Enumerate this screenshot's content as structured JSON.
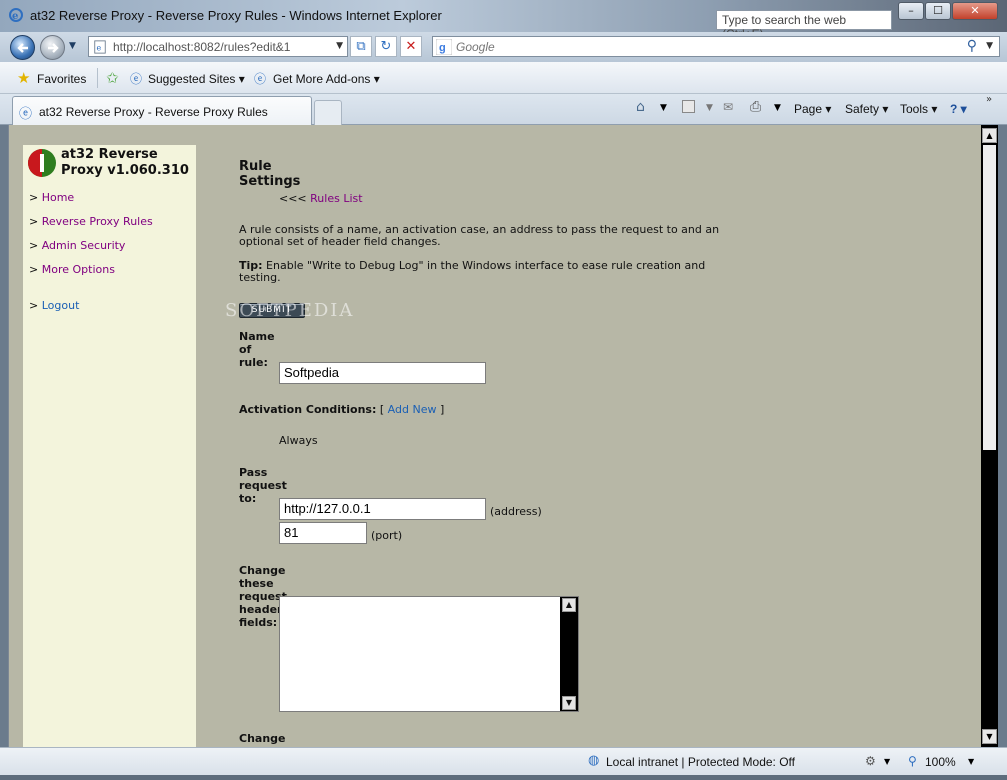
{
  "window": {
    "title": "at32 Reverse Proxy - Reverse Proxy Rules - Windows Internet Explorer",
    "search_web_placeholder": "Type to search the web (Ctrl+E)",
    "min_glyph": "–",
    "max_glyph": "☐",
    "close_glyph": "✕"
  },
  "address": {
    "url": "http://localhost:8082/rules?edit&1",
    "search_placeholder": "Google"
  },
  "favorites_bar": {
    "favorites": "Favorites",
    "suggested": "Suggested Sites ▾",
    "addons": "Get More Add-ons ▾"
  },
  "tab": {
    "label": "at32 Reverse Proxy - Reverse Proxy Rules"
  },
  "command_bar": {
    "page": "Page ▾",
    "safety": "Safety ▾",
    "tools": "Tools ▾",
    "help": "? ▾"
  },
  "sidebar": {
    "brand_line1": "at32 Reverse",
    "brand_line2": "Proxy v1.060.310",
    "items": [
      {
        "label": "Home"
      },
      {
        "label": "Reverse Proxy Rules"
      },
      {
        "label": "Admin Security"
      },
      {
        "label": "More Options"
      },
      {
        "label": "Logout"
      }
    ],
    "bullet": ">"
  },
  "main": {
    "heading": "Rule Settings",
    "back_prefix": "<<<",
    "back_link": "Rules List",
    "intro": "A rule consists of a name, an activation case, an address to pass the request to and an optional set of header field changes.",
    "tip_label": "Tip:",
    "tip_text": "Enable \"Write to Debug Log\" in the Windows interface to ease rule creation and testing.",
    "submit": "SUBMIT",
    "name_label": "Name of rule:",
    "name_value": "Softpedia",
    "activation_label": "Activation Conditions:",
    "add_new": "Add New",
    "activation_value": "Always",
    "pass_label": "Pass request to:",
    "address_value": "http://127.0.0.1",
    "address_hint": "(address)",
    "port_value": "81",
    "port_hint": "(port)",
    "req_headers_label": "Change these request header fields:",
    "resp_headers_label": "Change these response header fields:"
  },
  "watermark": "SOFTPEDIA",
  "status": {
    "zone": "Local intranet | Protected Mode: Off",
    "zoom": "100%"
  }
}
